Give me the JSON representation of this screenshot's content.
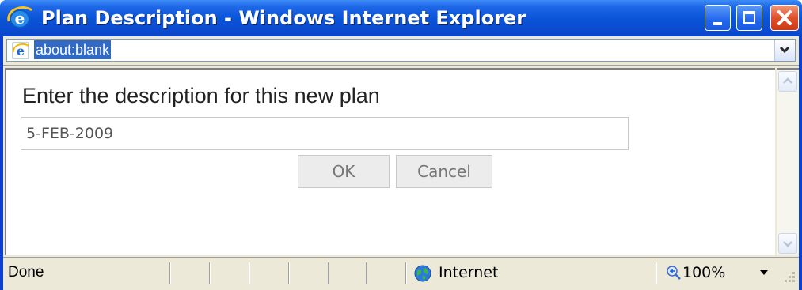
{
  "window": {
    "title": "Plan Description - Windows Internet Explorer",
    "title_icon": "ie-logo-icon",
    "controls": [
      "minimize-icon",
      "maximize-icon",
      "close-icon"
    ]
  },
  "address_bar": {
    "url": "about:blank",
    "icon": "ie-page-icon"
  },
  "dialog": {
    "prompt": "Enter the description for this new plan",
    "description_value": "5-FEB-2009",
    "ok_label": "OK",
    "cancel_label": "Cancel"
  },
  "status_bar": {
    "status": "Done",
    "zone_label": "Internet",
    "zone_icon": "globe-icon",
    "zoom_label": "100%",
    "zoom_icon": "zoom-icon"
  },
  "colors": {
    "titlebar": "#0a55d8",
    "close_button": "#e0502a",
    "chrome": "#ece9d8",
    "selection": "#316ac5"
  }
}
